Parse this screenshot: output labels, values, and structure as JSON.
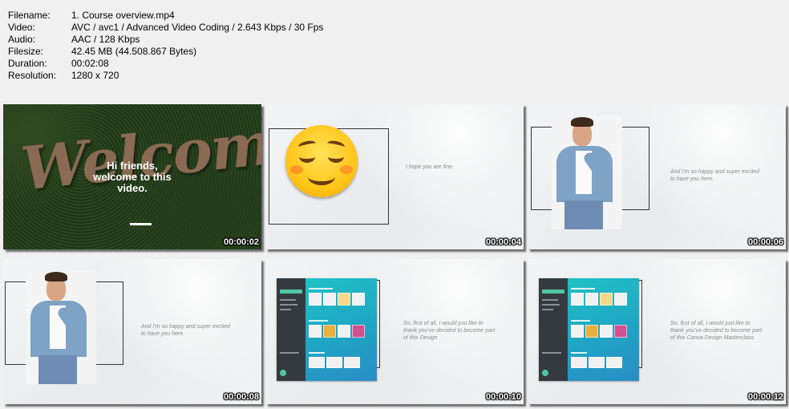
{
  "info": [
    {
      "key": "Filename:",
      "value": "1. Course overview.mp4"
    },
    {
      "key": "Video:",
      "value": "AVC / avc1 / Advanced Video Coding / 2.643 Kbps / 30 Fps"
    },
    {
      "key": "Audio:",
      "value": "AAC / 128 Kbps"
    },
    {
      "key": "Filesize:",
      "value": "42.45 MB (44.508.867 Bytes)"
    },
    {
      "key": "Duration:",
      "value": "00:02:08"
    },
    {
      "key": "Resolution:",
      "value": "1280 x 720"
    }
  ],
  "thumbs": [
    {
      "timestamp": "00:00:02",
      "welcome": "Welcome",
      "greeting_1": "Hi friends,",
      "greeting_2": "welcome to this",
      "greeting_3": "video."
    },
    {
      "timestamp": "00:00:04",
      "caption": "I hope you are fine."
    },
    {
      "timestamp": "00:00:06",
      "caption_1": "And I'm so happy and super excited",
      "caption_2": "to have you here."
    },
    {
      "timestamp": "00:00:08",
      "caption_1": "And I'm so happy and super excited",
      "caption_2": "to have you here."
    },
    {
      "timestamp": "00:00:10",
      "caption_1": "So, first of all, I would just like to",
      "caption_2": "thank you've decided  to  become  part",
      "caption_3": "of this Design"
    },
    {
      "timestamp": "00:00:12",
      "caption_1": "So, first of all, I would just like to",
      "caption_2": "thank you've decided to become part",
      "caption_3": "of this Canva Design Masterclass"
    }
  ],
  "colors": {
    "background": "#f0f0f0",
    "canva_teal": "#21c0c4",
    "canva_sidebar": "#343a40",
    "welcome_wood": "#8a6a52"
  }
}
